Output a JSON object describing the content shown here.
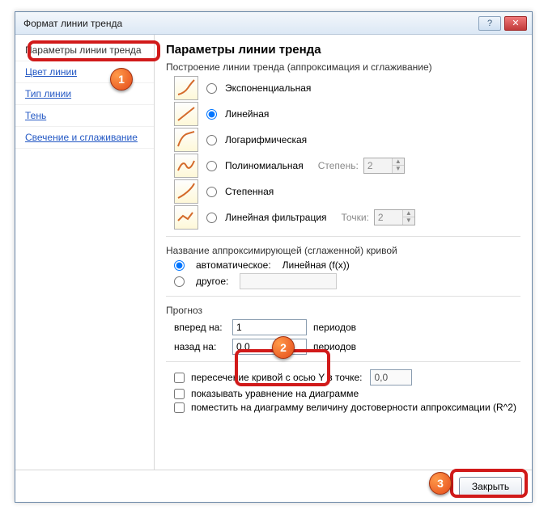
{
  "window": {
    "title": "Формат линии тренда"
  },
  "titlebar": {
    "help": "?",
    "close": "✕"
  },
  "sidebar": {
    "items": [
      {
        "label": "Параметры линии тренда"
      },
      {
        "label": "Цвет линии"
      },
      {
        "label": "Тип линии"
      },
      {
        "label": "Тень"
      },
      {
        "label": "Свечение и сглаживание"
      }
    ]
  },
  "content": {
    "title": "Параметры линии тренда",
    "build_label": "Построение линии тренда (аппроксимация и сглаживание)",
    "types": {
      "exp": "Экспоненциальная",
      "lin": "Линейная",
      "log": "Логарифмическая",
      "poly": "Полиномиальная",
      "pow": "Степенная",
      "mov": "Линейная фильтрация",
      "degree_label": "Степень:",
      "degree_value": "2",
      "points_label": "Точки:",
      "points_value": "2"
    },
    "name": {
      "group": "Название аппроксимирующей (сглаженной) кривой",
      "auto": "автоматическое:",
      "auto_value": "Линейная (f(x))",
      "other": "другое:"
    },
    "forecast": {
      "group": "Прогноз",
      "fwd_label": "вперед на:",
      "fwd_value": "1",
      "back_label": "назад на:",
      "back_value": "0,0",
      "periods": "периодов"
    },
    "checks": {
      "intercept": "пересечение кривой с осью Y в точке:",
      "intercept_value": "0,0",
      "show_eq": "показывать уравнение на диаграмме",
      "show_r2": "поместить на диаграмму величину достоверности аппроксимации (R^2)"
    }
  },
  "footer": {
    "close": "Закрыть"
  },
  "callouts": {
    "c1": "1",
    "c2": "2",
    "c3": "3"
  }
}
